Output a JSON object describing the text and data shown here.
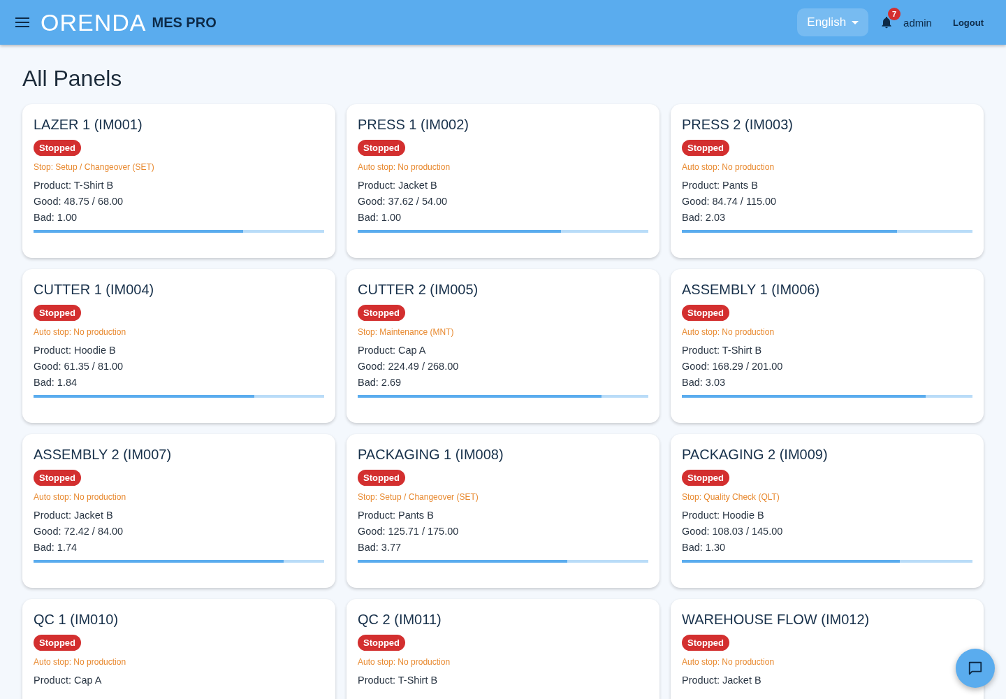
{
  "header": {
    "logo": "ORENDA",
    "product": "MES PRO",
    "language": "English",
    "notifications": "7",
    "user": "admin",
    "logout": "Logout"
  },
  "title": "All Panels",
  "panels": [
    {
      "name": "LAZER 1 (IM001)",
      "status": {
        "label": "Stopped",
        "kind": "stopped"
      },
      "reason": "Stop: Setup / Changeover (SET)",
      "product": "Product: T-Shirt B",
      "good": "Good: 48.75 / 68.00",
      "bad": "Bad: 1.00",
      "level": 0.72
    },
    {
      "name": "PRESS 1 (IM002)",
      "status": {
        "label": "Stopped",
        "kind": "stopped"
      },
      "reason": "Auto stop: No production",
      "product": "Product: Jacket B",
      "good": "Good: 37.62 / 54.00",
      "bad": "Bad: 1.00",
      "level": 0.7
    },
    {
      "name": "PRESS 2 (IM003)",
      "status": {
        "label": "Stopped",
        "kind": "stopped"
      },
      "reason": "Auto stop: No production",
      "product": "Product: Pants B",
      "good": "Good: 84.74 / 115.00",
      "bad": "Bad: 2.03",
      "level": 0.74
    },
    {
      "name": "CUTTER 1 (IM004)",
      "status": {
        "label": "Stopped",
        "kind": "stopped"
      },
      "reason": "Auto stop: No production",
      "product": "Product: Hoodie B",
      "good": "Good: 61.35 / 81.00",
      "bad": "Bad: 1.84",
      "level": 0.76
    },
    {
      "name": "CUTTER 2 (IM005)",
      "status": {
        "label": "Stopped",
        "kind": "stopped"
      },
      "reason": "Stop: Maintenance (MNT)",
      "product": "Product: Cap A",
      "good": "Good: 224.49 / 268.00",
      "bad": "Bad: 2.69",
      "level": 0.84
    },
    {
      "name": "ASSEMBLY 1 (IM006)",
      "status": {
        "label": "Stopped",
        "kind": "stopped"
      },
      "reason": "Auto stop: No production",
      "product": "Product: T-Shirt B",
      "good": "Good: 168.29 / 201.00",
      "bad": "Bad: 3.03",
      "level": 0.84
    },
    {
      "name": "ASSEMBLY 2 (IM007)",
      "status": {
        "label": "Stopped",
        "kind": "stopped"
      },
      "reason": "Auto stop: No production",
      "product": "Product: Jacket B",
      "good": "Good: 72.42 / 84.00",
      "bad": "Bad: 1.74",
      "level": 0.86
    },
    {
      "name": "PACKAGING 1 (IM008)",
      "status": {
        "label": "Stopped",
        "kind": "stopped"
      },
      "reason": "Stop: Setup / Changeover (SET)",
      "product": "Product: Pants B",
      "good": "Good: 125.71 / 175.00",
      "bad": "Bad: 3.77",
      "level": 0.72
    },
    {
      "name": "PACKAGING 2 (IM009)",
      "status": {
        "label": "Stopped",
        "kind": "stopped"
      },
      "reason": "Stop: Quality Check (QLT)",
      "product": "Product: Hoodie B",
      "good": "Good: 108.03 / 145.00",
      "bad": "Bad: 1.30",
      "level": 0.75
    },
    {
      "name": "QC 1 (IM010)",
      "status": {
        "label": "Stopped",
        "kind": "stopped"
      },
      "reason": "Auto stop: No production",
      "product": "Product: Cap A"
    },
    {
      "name": "QC 2 (IM011)",
      "status": {
        "label": "Stopped",
        "kind": "stopped"
      },
      "reason": "Auto stop: No production",
      "product": "Product: T-Shirt B"
    },
    {
      "name": "WAREHOUSE FLOW (IM012)",
      "status": {
        "label": "Stopped",
        "kind": "stopped"
      },
      "reason": "Auto stop: No production",
      "product": "Product: Jacket B"
    }
  ]
}
